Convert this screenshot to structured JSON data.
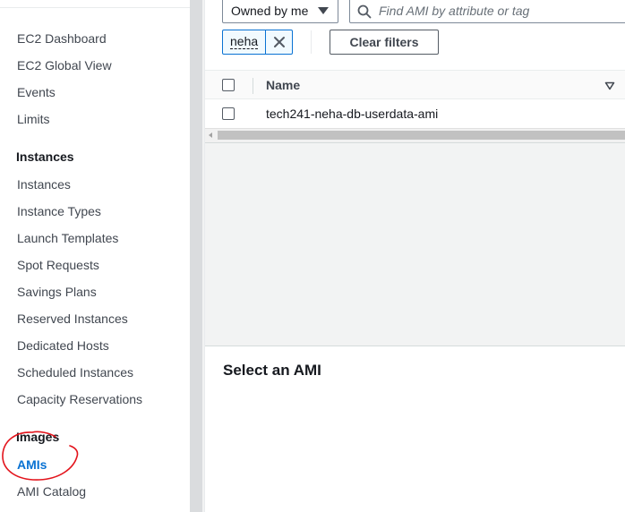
{
  "sidebar": {
    "items": [
      {
        "label": "EC2 Dashboard"
      },
      {
        "label": "EC2 Global View"
      },
      {
        "label": "Events"
      },
      {
        "label": "Limits"
      }
    ],
    "sections": [
      {
        "heading": "Instances",
        "items": [
          {
            "label": "Instances"
          },
          {
            "label": "Instance Types"
          },
          {
            "label": "Launch Templates"
          },
          {
            "label": "Spot Requests"
          },
          {
            "label": "Savings Plans"
          },
          {
            "label": "Reserved Instances"
          },
          {
            "label": "Dedicated Hosts"
          },
          {
            "label": "Scheduled Instances"
          },
          {
            "label": "Capacity Reservations"
          }
        ]
      },
      {
        "heading": "Images",
        "items": [
          {
            "label": "AMIs",
            "active": true
          },
          {
            "label": "AMI Catalog"
          }
        ]
      }
    ]
  },
  "filter": {
    "owner_value": "Owned by me",
    "search_placeholder": "Find AMI by attribute or tag",
    "token_label": "neha",
    "clear_label": "Clear filters"
  },
  "table": {
    "columns": [
      {
        "label": "Name"
      }
    ],
    "rows": [
      {
        "name": "tech241-neha-db-userdata-ami"
      }
    ]
  },
  "details": {
    "title": "Select an AMI"
  },
  "colors": {
    "accent": "#0972d3",
    "annotation": "#e3141c"
  },
  "icons": {
    "owner_caret": "caret-down-icon",
    "search": "search-icon",
    "token_dismiss": "close-icon",
    "sort": "sort-down-icon",
    "annotation": "red-hand-drawn-circle"
  }
}
